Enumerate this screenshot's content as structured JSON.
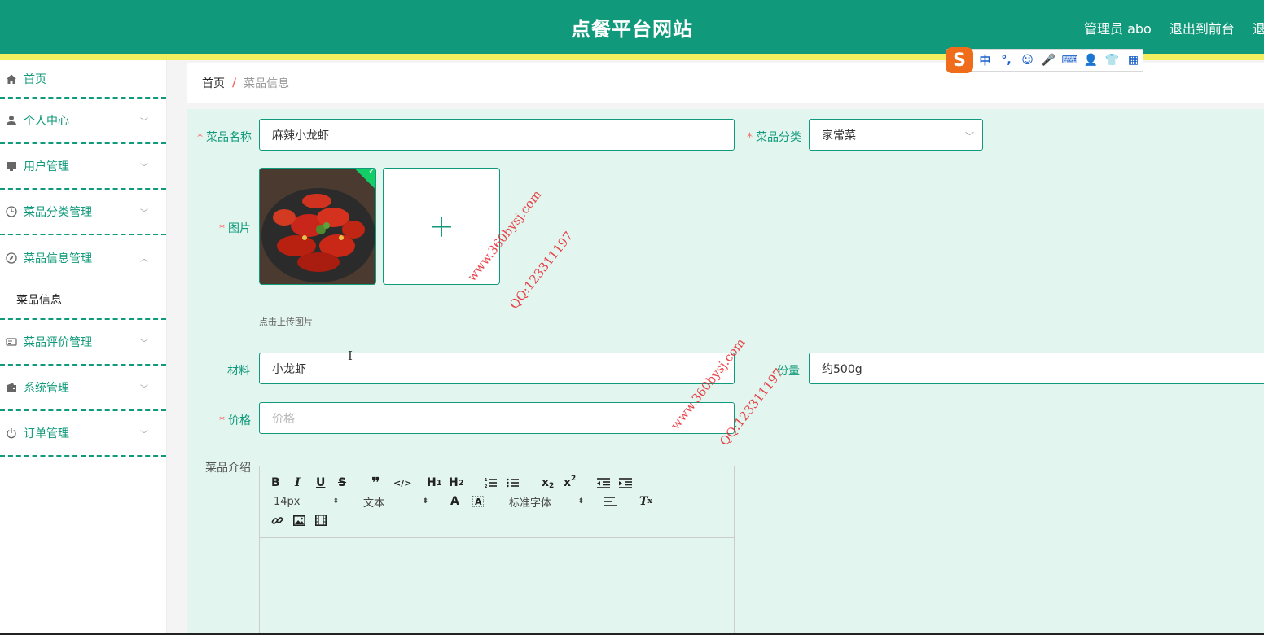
{
  "header": {
    "site_title": "点餐平台网站",
    "admin_label": "管理员 abo",
    "back_to_front": "退出到前台",
    "logout_partial": "退"
  },
  "ime": {
    "logo": "S",
    "items": [
      "中",
      "°,",
      "☺",
      "🎤",
      "⌨",
      "👤",
      "👕",
      "▦"
    ]
  },
  "sidebar": {
    "items": [
      {
        "label": "首页",
        "icon": "home-icon",
        "expandable": false
      },
      {
        "label": "个人中心",
        "icon": "user-icon",
        "expandable": true
      },
      {
        "label": "用户管理",
        "icon": "monitor-icon",
        "expandable": true
      },
      {
        "label": "菜品分类管理",
        "icon": "clock-icon",
        "expandable": true
      },
      {
        "label": "菜品信息管理",
        "icon": "compass-icon",
        "expandable": true,
        "expanded": true
      },
      {
        "label": "菜品评价管理",
        "icon": "card-icon",
        "expandable": true
      },
      {
        "label": "系统管理",
        "icon": "wallet-icon",
        "expandable": true
      },
      {
        "label": "订单管理",
        "icon": "power-icon",
        "expandable": true
      }
    ],
    "submenu": {
      "label": "菜品信息"
    }
  },
  "breadcrumb": {
    "home": "首页",
    "separator": "/",
    "current": "菜品信息"
  },
  "form": {
    "name_label": "菜品名称",
    "name_value": "麻辣小龙虾",
    "category_label": "菜品分类",
    "category_value": "家常菜",
    "image_label": "图片",
    "upload_tip": "点击上传图片",
    "material_label": "材料",
    "material_value": "小龙虾",
    "portion_label": "份量",
    "portion_value": "约500g",
    "price_label": "价格",
    "price_placeholder": "价格",
    "intro_label": "菜品介绍"
  },
  "editor": {
    "buttons": [
      "B",
      "I",
      "U",
      "S",
      "❞",
      "</>",
      "H1",
      "H2",
      "ol",
      "ul",
      "x₂",
      "x²",
      "outdent",
      "indent"
    ],
    "font_size": "14px",
    "text_type": "文本",
    "font_family": "标准字体"
  },
  "watermark": {
    "site": "www.360bysj.com",
    "qq": "QQ:123311197"
  },
  "colors": {
    "primary": "#10997a",
    "stripe": "#f2ee5f",
    "panel": "#e2f5ee",
    "required": "#f56c6c"
  }
}
